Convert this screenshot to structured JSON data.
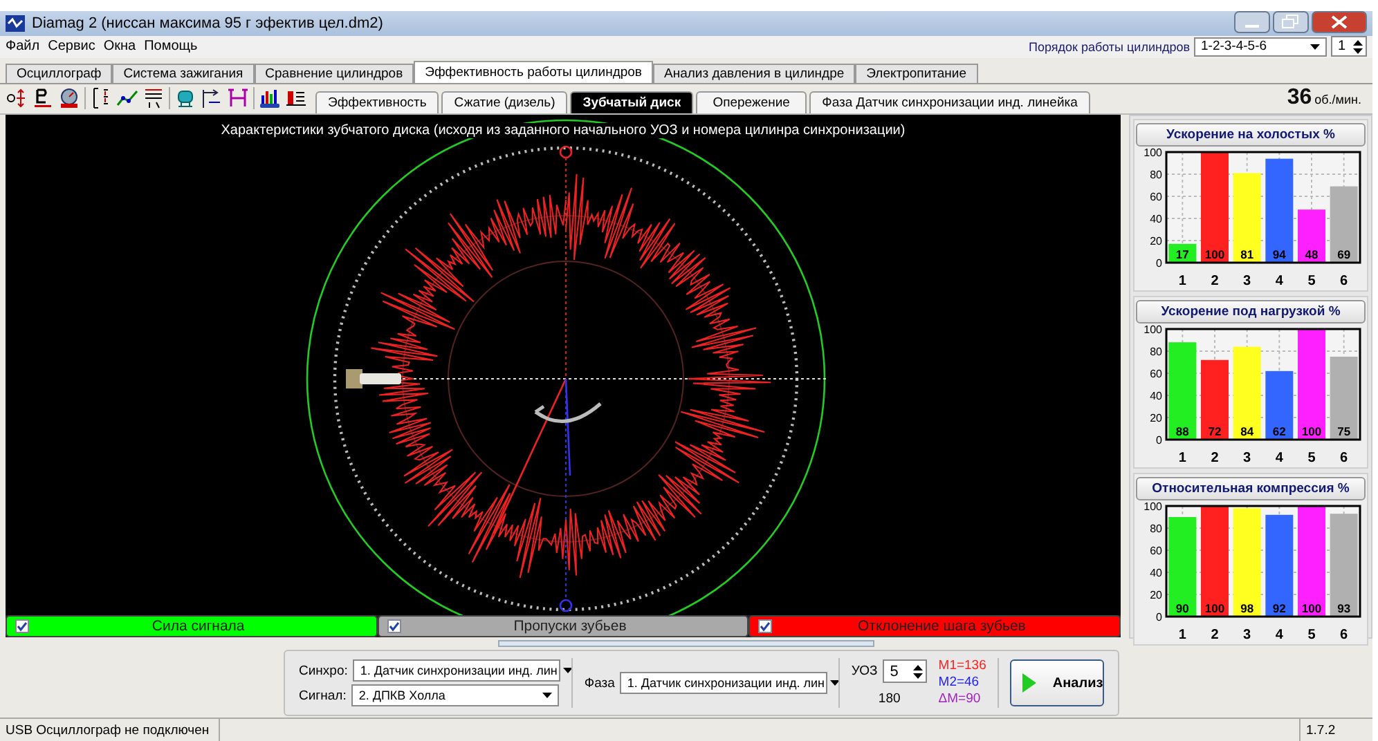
{
  "window": {
    "title": "Diamag 2 (ниссан максима 95 г эфектив цел.dm2)"
  },
  "menu": [
    "Файл",
    "Сервис",
    "Окна",
    "Помощь"
  ],
  "cylinder_order": {
    "label": "Порядок работы цилиндров",
    "value": "1-2-3-4-5-6",
    "cylinder": "1"
  },
  "tabs": [
    {
      "label": "Осциллограф",
      "selected": false
    },
    {
      "label": "Система зажигания",
      "selected": false
    },
    {
      "label": "Сравнение цилиндров",
      "selected": false
    },
    {
      "label": "Эффективность работы цилиндров",
      "selected": true
    },
    {
      "label": "Анализ давления в цилиндре",
      "selected": false
    },
    {
      "label": "Электропитание",
      "selected": false
    }
  ],
  "subtabs": [
    {
      "label": "Эффективность",
      "selected": false
    },
    {
      "label": "Сжатие (дизель)",
      "selected": false
    },
    {
      "label": "Зубчатый диск",
      "selected": true
    },
    {
      "label": "Опережение",
      "selected": false
    },
    {
      "label": "Фаза Датчик синхронизации инд. линейка",
      "selected": false
    }
  ],
  "rpm": {
    "value": "36",
    "unit": "об./мин."
  },
  "plot": {
    "title": "Характеристики зубчатого диска (исходя из заданного начального УОЗ и номера цилинра синхронизации)"
  },
  "legend": [
    {
      "label": "Сила сигнала",
      "checked": true,
      "color": "#00ff00"
    },
    {
      "label": "Пропуски зубьев",
      "checked": true,
      "color": "#a9a9a9"
    },
    {
      "label": "Отклонение шага зубьев",
      "checked": true,
      "color": "#ff0000"
    }
  ],
  "cylinders": [
    {
      "color": "#22ee22"
    },
    {
      "color": "#ff2020"
    },
    {
      "color": "#ffff20"
    },
    {
      "color": "#3366ff"
    },
    {
      "color": "#ff20ff"
    },
    {
      "color": "#b0b0b0"
    }
  ],
  "charts": [
    {
      "chart_data": {
        "type": "bar",
        "title": "Ускорение на холостых %",
        "categories": [
          "1",
          "2",
          "3",
          "4",
          "5",
          "6"
        ],
        "series": [
          {
            "values": [
              17,
              100,
              81,
              94,
              48,
              69
            ]
          }
        ],
        "ylim": [
          0,
          100
        ],
        "yticks": [
          0,
          20,
          40,
          60,
          80,
          100
        ],
        "grid": true,
        "data_labels": true
      }
    },
    {
      "chart_data": {
        "type": "bar",
        "title": "Ускорение под нагрузкой %",
        "categories": [
          "1",
          "2",
          "3",
          "4",
          "5",
          "6"
        ],
        "series": [
          {
            "values": [
              88,
              72,
              84,
              62,
              100,
              75
            ]
          }
        ],
        "ylim": [
          0,
          100
        ],
        "yticks": [
          0,
          20,
          40,
          60,
          80,
          100
        ],
        "grid": true,
        "data_labels": true
      }
    },
    {
      "chart_data": {
        "type": "bar",
        "title": "Относительная компрессия %",
        "categories": [
          "1",
          "2",
          "3",
          "4",
          "5",
          "6"
        ],
        "series": [
          {
            "values": [
              90,
              100,
              98,
              92,
              100,
              93
            ]
          }
        ],
        "ylim": [
          0,
          100
        ],
        "yticks": [
          0,
          20,
          40,
          60,
          80,
          100
        ],
        "grid": true,
        "data_labels": true
      }
    }
  ],
  "controls": {
    "sync": {
      "label": "Синхро:",
      "value": "1.  Датчик синхронизации инд. лин"
    },
    "signal": {
      "label": "Сигнал:",
      "value": "2.  ДПКВ Холла"
    },
    "phase": {
      "label": "Фаза",
      "value": "1.  Датчик синхронизации инд. лин"
    },
    "uoz": {
      "label": "УОЗ",
      "value": "5"
    },
    "angle": "180",
    "marks": [
      {
        "text": "M1=136",
        "color": "#ff2020"
      },
      {
        "text": "M2=46",
        "color": "#2020ff"
      },
      {
        "text": "ΔM=90",
        "color": "#a020c0"
      }
    ],
    "analyze": "Анализ"
  },
  "status_bar": [
    "USB Осциллограф не подключен",
    "1.7.2"
  ]
}
